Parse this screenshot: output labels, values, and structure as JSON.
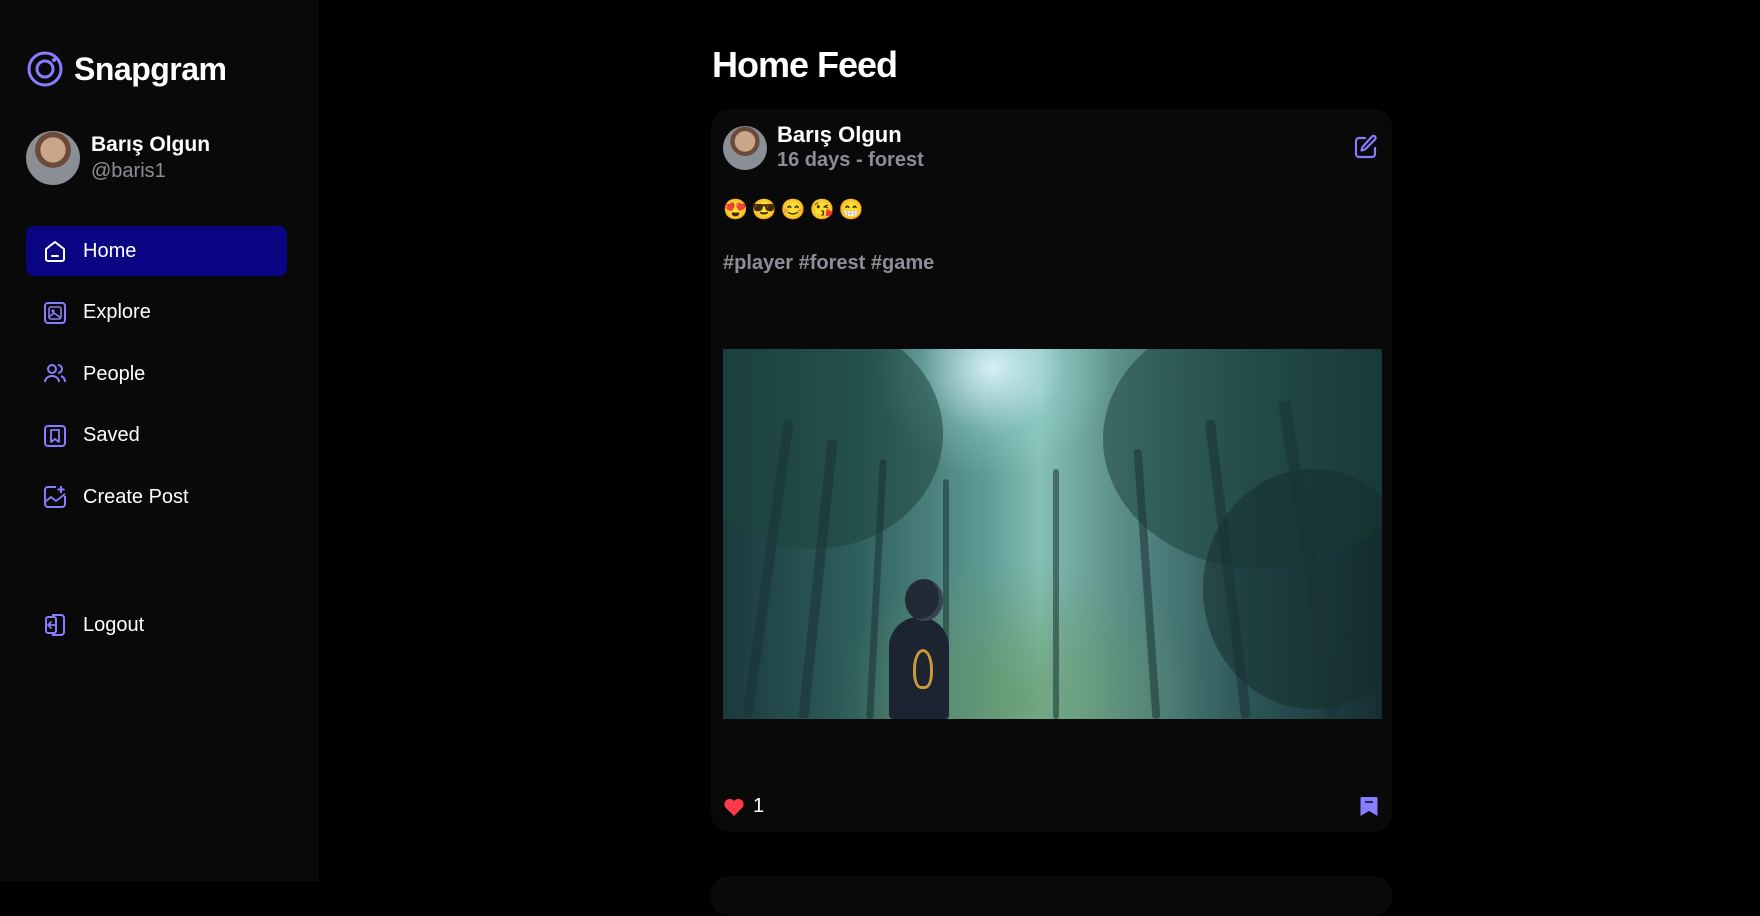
{
  "app": {
    "name": "Snapgram",
    "accent": "#877eff",
    "active_nav_bg": "#0a0582"
  },
  "user": {
    "name": "Barış Olgun",
    "handle": "@baris1"
  },
  "nav": {
    "items": [
      {
        "label": "Home",
        "icon": "home-icon",
        "active": true
      },
      {
        "label": "Explore",
        "icon": "explore-icon",
        "active": false
      },
      {
        "label": "People",
        "icon": "people-icon",
        "active": false
      },
      {
        "label": "Saved",
        "icon": "bookmark-icon",
        "active": false
      },
      {
        "label": "Create Post",
        "icon": "create-post-icon",
        "active": false
      }
    ],
    "logout_label": "Logout"
  },
  "feed": {
    "title": "Home Feed",
    "post": {
      "author": "Barış Olgun",
      "meta": "16 days - forest",
      "caption": "😍😎😊😘😁",
      "tags": "#player #forest #game",
      "likes": "1",
      "liked": true,
      "saved": true
    }
  }
}
